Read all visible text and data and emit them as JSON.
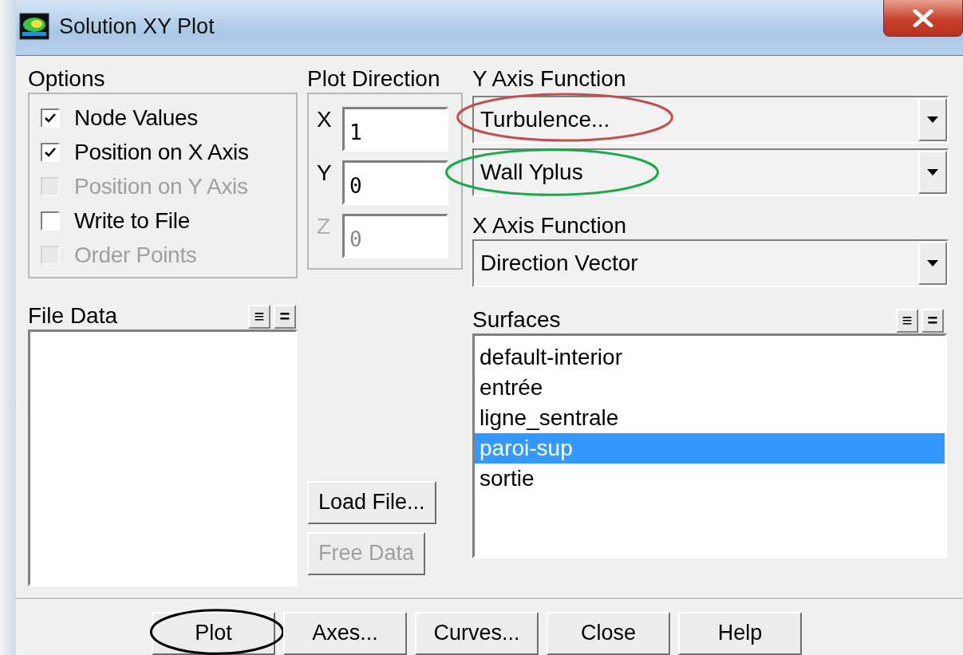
{
  "window": {
    "title": "Solution XY Plot"
  },
  "options": {
    "label": "Options",
    "items": [
      {
        "label": "Node Values",
        "checked": true,
        "disabled": false
      },
      {
        "label": "Position on X Axis",
        "checked": true,
        "disabled": false
      },
      {
        "label": "Position on Y Axis",
        "checked": false,
        "disabled": true
      },
      {
        "label": "Write to File",
        "checked": false,
        "disabled": false
      },
      {
        "label": "Order Points",
        "checked": false,
        "disabled": true
      }
    ]
  },
  "plot_direction": {
    "label": "Plot Direction",
    "fields": [
      {
        "axis": "X",
        "value": "1",
        "disabled": false
      },
      {
        "axis": "Y",
        "value": "0",
        "disabled": false
      },
      {
        "axis": "Z",
        "value": "0",
        "disabled": true
      }
    ]
  },
  "y_axis_function": {
    "label": "Y Axis Function",
    "category": {
      "value": "Turbulence...",
      "color": "#c0504d"
    },
    "quantity": {
      "value": "Wall Yplus",
      "color": "#1aa84a"
    }
  },
  "x_axis_function": {
    "label": "X Axis Function",
    "value": "Direction Vector"
  },
  "file_data": {
    "label": "File Data",
    "buttons": [
      "≡",
      "="
    ]
  },
  "surfaces": {
    "label": "Surfaces",
    "buttons": [
      "≡",
      "="
    ],
    "items": [
      {
        "label": "default-interior",
        "selected": false
      },
      {
        "label": "entrée",
        "selected": false
      },
      {
        "label": "ligne_sentrale",
        "selected": false
      },
      {
        "label": "paroi-sup",
        "selected": true
      },
      {
        "label": "sortie",
        "selected": false
      }
    ]
  },
  "file_buttons": [
    {
      "label": "Load File...",
      "disabled": false
    },
    {
      "label": "Free Data",
      "disabled": true
    }
  ],
  "buttons": [
    {
      "label": "Plot",
      "color": "#000000"
    },
    {
      "label": "Axes..."
    },
    {
      "label": "Curves..."
    },
    {
      "label": "Close"
    },
    {
      "label": "Help"
    }
  ]
}
